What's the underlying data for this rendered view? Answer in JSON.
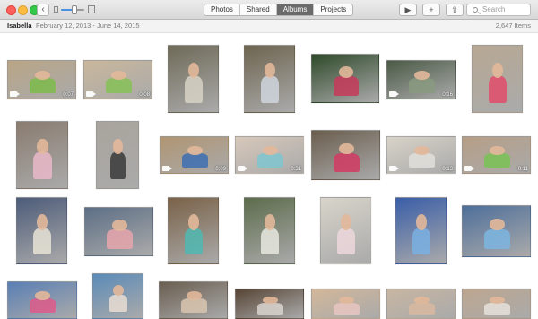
{
  "toolbar": {
    "back_glyph": "‹",
    "tabs": [
      {
        "label": "Photos",
        "active": false
      },
      {
        "label": "Shared",
        "active": false
      },
      {
        "label": "Albums",
        "active": true
      },
      {
        "label": "Projects",
        "active": false
      }
    ],
    "play_glyph": "▶",
    "add_glyph": "+",
    "share_glyph": "⇪",
    "search_placeholder": "Search"
  },
  "album": {
    "name": "Isabella",
    "dates": "February 12, 2013 - June 14, 2015",
    "count": "2,647 Items"
  },
  "photos": [
    {
      "id": 1,
      "video": true,
      "duration": "0:07",
      "bg": "#b9a586",
      "body": "#7dbb4b"
    },
    {
      "id": 2,
      "video": true,
      "duration": "0:08",
      "bg": "#c9b79c",
      "body": "#86c157"
    },
    {
      "id": 3,
      "video": false,
      "duration": "",
      "bg": "#6f6a58",
      "body": "#d7d2c4"
    },
    {
      "id": 4,
      "video": false,
      "duration": "",
      "bg": "#6e6550",
      "body": "#cfd6de"
    },
    {
      "id": 5,
      "video": false,
      "duration": "",
      "bg": "#2f4a2a",
      "body": "#c73a5a"
    },
    {
      "id": 6,
      "video": true,
      "duration": "0:16",
      "bg": "#4b5a46",
      "body": "#8a9a80"
    },
    {
      "id": 7,
      "video": false,
      "duration": "",
      "bg": "#b7a893",
      "body": "#e04c6a"
    },
    {
      "id": 8,
      "video": false,
      "duration": "",
      "bg": "#8a7c70",
      "body": "#e9b8c9"
    },
    {
      "id": 9,
      "video": false,
      "duration": "",
      "bg": "#a9a49d",
      "body": "#3a3a3a"
    },
    {
      "id": 10,
      "video": true,
      "duration": "0:09",
      "bg": "#b09572",
      "body": "#3d6fb3"
    },
    {
      "id": 11,
      "video": true,
      "duration": "0:31",
      "bg": "#d7c8ba",
      "body": "#7fc6d0"
    },
    {
      "id": 12,
      "video": false,
      "duration": "",
      "bg": "#6b5e4e",
      "body": "#d23b63"
    },
    {
      "id": 13,
      "video": true,
      "duration": "0:13",
      "bg": "#d8d3c8",
      "body": "#e0dfda"
    },
    {
      "id": 14,
      "video": true,
      "duration": "0:11",
      "bg": "#b69e86",
      "body": "#79c255"
    },
    {
      "id": 15,
      "video": false,
      "duration": "",
      "bg": "#4d5c7a",
      "body": "#e8e3d6"
    },
    {
      "id": 16,
      "video": false,
      "duration": "",
      "bg": "#5d6f86",
      "body": "#e7a4ab"
    },
    {
      "id": 17,
      "video": false,
      "duration": "",
      "bg": "#7a6248",
      "body": "#4fb9b2"
    },
    {
      "id": 18,
      "video": false,
      "duration": "",
      "bg": "#5d6c4c",
      "body": "#e8e8e0"
    },
    {
      "id": 19,
      "video": false,
      "duration": "",
      "bg": "#d8d4ca",
      "body": "#ecd7dc"
    },
    {
      "id": 20,
      "video": false,
      "duration": "",
      "bg": "#3a5ea8",
      "body": "#7ab0e3"
    },
    {
      "id": 21,
      "video": false,
      "duration": "",
      "bg": "#4e6f9a",
      "body": "#7db6e0"
    },
    {
      "id": 22,
      "video": false,
      "duration": "",
      "bg": "#5a7fb4",
      "body": "#de5b8a"
    },
    {
      "id": 23,
      "video": false,
      "duration": "",
      "bg": "#5b8bb8",
      "body": "#e9ddd2"
    },
    {
      "id": 24,
      "video": false,
      "duration": "",
      "bg": "#6a5e50",
      "body": "#d9c6b0"
    },
    {
      "id": 25,
      "video": false,
      "duration": "",
      "bg": "#574535",
      "body": "#d9d3cf"
    },
    {
      "id": 26,
      "video": false,
      "duration": "",
      "bg": "#d3b79a",
      "body": "#e7c6c2"
    },
    {
      "id": 27,
      "video": false,
      "duration": "",
      "bg": "#c8b6a2",
      "body": "#d8b9a0"
    },
    {
      "id": 28,
      "video": false,
      "duration": "",
      "bg": "#bda68f",
      "body": "#e6e2dc"
    },
    {
      "id": 29,
      "video": false,
      "duration": "",
      "bg": "#b8a88e",
      "body": "#e8e8e0"
    }
  ]
}
